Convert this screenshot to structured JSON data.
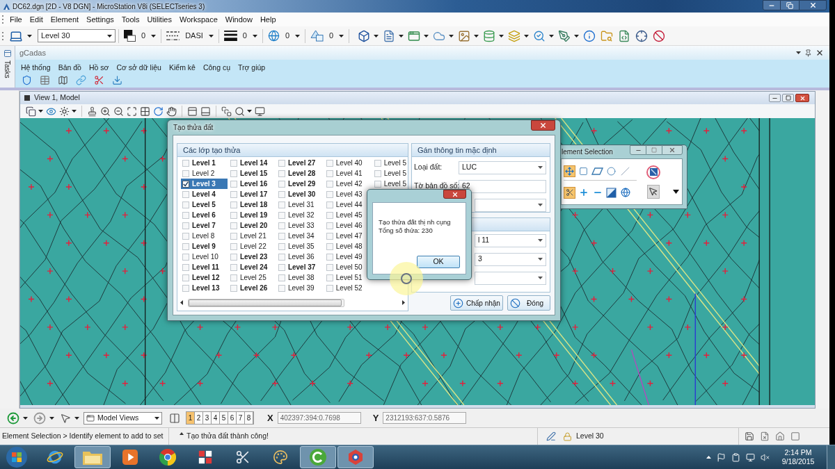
{
  "window": {
    "title": "DC62.dgn [2D - V8 DGN] - MicroStation V8i (SELECTseries 3)"
  },
  "menu": [
    "File",
    "Edit",
    "Element",
    "Settings",
    "Tools",
    "Utilities",
    "Workspace",
    "Window",
    "Help"
  ],
  "toolbar": {
    "level": "Level 30",
    "attributes": [
      {
        "kind": "color",
        "value": "0"
      },
      {
        "kind": "style",
        "value": "DASI"
      },
      {
        "kind": "weight",
        "value": "0"
      },
      {
        "kind": "globe",
        "value": "0"
      },
      {
        "kind": "shapes",
        "value": "0"
      }
    ]
  },
  "tasks_strip": {
    "label": "Tasks"
  },
  "gcadas": {
    "title": "gCadas",
    "menu": [
      "Hệ thống",
      "Bản đồ",
      "Hồ sơ",
      "Cơ sở dữ liệu",
      "Kiểm kê",
      "Công cụ",
      "Trợ giúp"
    ]
  },
  "view": {
    "title": "View 1, Model"
  },
  "dialog": {
    "title": "Tạo thửa đất",
    "levels": {
      "title": "Các lớp tạo thửa",
      "columns": [
        [
          {
            "label": "Level 1",
            "used": true,
            "checked": false,
            "selected": false
          },
          {
            "label": "Level 2",
            "used": false,
            "checked": false,
            "selected": false
          },
          {
            "label": "Level 3",
            "used": true,
            "checked": true,
            "selected": true
          },
          {
            "label": "Level 4",
            "used": true,
            "checked": false,
            "selected": false
          },
          {
            "label": "Level 5",
            "used": true,
            "checked": false,
            "selected": false
          },
          {
            "label": "Level 6",
            "used": true,
            "checked": false,
            "selected": false
          },
          {
            "label": "Level 7",
            "used": true,
            "checked": false,
            "selected": false
          },
          {
            "label": "Level 8",
            "used": false,
            "checked": false,
            "selected": false
          },
          {
            "label": "Level 9",
            "used": true,
            "checked": false,
            "selected": false
          },
          {
            "label": "Level 10",
            "used": false,
            "checked": false,
            "selected": false
          },
          {
            "label": "Level 11",
            "used": true,
            "checked": false,
            "selected": false
          },
          {
            "label": "Level 12",
            "used": true,
            "checked": false,
            "selected": false
          },
          {
            "label": "Level 13",
            "used": true,
            "checked": false,
            "selected": false
          }
        ],
        [
          {
            "label": "Level 14",
            "used": true,
            "checked": false,
            "selected": false
          },
          {
            "label": "Level 15",
            "used": true,
            "checked": false,
            "selected": false
          },
          {
            "label": "Level 16",
            "used": true,
            "checked": false,
            "selected": false
          },
          {
            "label": "Level 17",
            "used": true,
            "checked": false,
            "selected": false
          },
          {
            "label": "Level 18",
            "used": true,
            "checked": false,
            "selected": false
          },
          {
            "label": "Level 19",
            "used": true,
            "checked": false,
            "selected": false
          },
          {
            "label": "Level 20",
            "used": true,
            "checked": false,
            "selected": false
          },
          {
            "label": "Level 21",
            "used": false,
            "checked": false,
            "selected": false
          },
          {
            "label": "Level 22",
            "used": false,
            "checked": false,
            "selected": false
          },
          {
            "label": "Level 23",
            "used": true,
            "checked": false,
            "selected": false
          },
          {
            "label": "Level 24",
            "used": true,
            "checked": false,
            "selected": false
          },
          {
            "label": "Level 25",
            "used": false,
            "checked": false,
            "selected": false
          },
          {
            "label": "Level 26",
            "used": true,
            "checked": false,
            "selected": false
          }
        ],
        [
          {
            "label": "Level 27",
            "used": true,
            "checked": false,
            "selected": false
          },
          {
            "label": "Level 28",
            "used": true,
            "checked": false,
            "selected": false
          },
          {
            "label": "Level 29",
            "used": true,
            "checked": false,
            "selected": false
          },
          {
            "label": "Level 30",
            "used": true,
            "checked": false,
            "selected": false
          },
          {
            "label": "Level 31",
            "used": false,
            "checked": false,
            "selected": false
          },
          {
            "label": "Level 32",
            "used": false,
            "checked": false,
            "selected": false
          },
          {
            "label": "Level 33",
            "used": false,
            "checked": false,
            "selected": false
          },
          {
            "label": "Level 34",
            "used": false,
            "checked": false,
            "selected": false
          },
          {
            "label": "Level 35",
            "used": false,
            "checked": false,
            "selected": false
          },
          {
            "label": "Level 36",
            "used": false,
            "checked": false,
            "selected": false
          },
          {
            "label": "Level 37",
            "used": true,
            "checked": false,
            "selected": false
          },
          {
            "label": "Level 38",
            "used": false,
            "checked": false,
            "selected": false
          },
          {
            "label": "Level 39",
            "used": false,
            "checked": false,
            "selected": false
          }
        ],
        [
          {
            "label": "Level 40",
            "used": false,
            "checked": false,
            "selected": false
          },
          {
            "label": "Level 41",
            "used": false,
            "checked": false,
            "selected": false
          },
          {
            "label": "Level 42",
            "used": false,
            "checked": false,
            "selected": false
          },
          {
            "label": "Level 43",
            "used": false,
            "checked": false,
            "selected": false
          },
          {
            "label": "Level 44",
            "used": false,
            "checked": false,
            "selected": false
          },
          {
            "label": "Level 45",
            "used": false,
            "checked": false,
            "selected": false
          },
          {
            "label": "Level 46",
            "used": false,
            "checked": false,
            "selected": false
          },
          {
            "label": "Level 47",
            "used": false,
            "checked": false,
            "selected": false
          },
          {
            "label": "Level 48",
            "used": false,
            "checked": false,
            "selected": false
          },
          {
            "label": "Level 49",
            "used": false,
            "checked": false,
            "selected": false
          },
          {
            "label": "Level 50",
            "used": false,
            "checked": false,
            "selected": false
          },
          {
            "label": "Level 51",
            "used": false,
            "checked": false,
            "selected": false
          },
          {
            "label": "Level 52",
            "used": false,
            "checked": false,
            "selected": false
          }
        ],
        [
          {
            "label": "Level 5",
            "used": false,
            "checked": false,
            "selected": false
          },
          {
            "label": "Level 5",
            "used": false,
            "checked": false,
            "selected": false
          },
          {
            "label": "Level 5",
            "used": false,
            "checked": false,
            "selected": false
          }
        ]
      ]
    },
    "defaults": {
      "title": "Gán thông tin mặc định",
      "fields": [
        {
          "kind": "dropdown",
          "label": "Loại đất:",
          "value": "LUC"
        },
        {
          "kind": "text",
          "label": "Tờ bản đồ số:",
          "value": "62"
        },
        {
          "kind": "dropdown"
        }
      ]
    },
    "options": {
      "fields": [
        {
          "kind": "dropdown",
          "value": "l 11"
        },
        {
          "kind": "dropdown",
          "value": "3"
        },
        {
          "kind": "dropdown"
        }
      ]
    },
    "buttons": [
      {
        "kind": "accept",
        "label": "Chấp nhận"
      },
      {
        "kind": "close",
        "label": "Đóng"
      }
    ]
  },
  "message_box": {
    "lines": [
      "Tạo thửa đất thị nh cụng",
      "Tổng số thửa: 230"
    ],
    "button": "OK"
  },
  "element_selection": {
    "title": "lement Selection"
  },
  "bottom_toolbar": {
    "view_group": "Model Views",
    "views": [
      {
        "label": "1",
        "selected": true
      },
      {
        "label": "2",
        "selected": false
      },
      {
        "label": "3",
        "selected": false
      },
      {
        "label": "4",
        "selected": false
      },
      {
        "label": "5",
        "selected": false
      },
      {
        "label": "6",
        "selected": false
      },
      {
        "label": "7",
        "selected": false
      },
      {
        "label": "8",
        "selected": false
      }
    ],
    "x": {
      "label": "X",
      "value": "402397:394:0.7698"
    },
    "y": {
      "label": "Y",
      "value": "2312193:637:0.5876"
    }
  },
  "status_bar": {
    "prompt": "Element Selection > Identify element to add to set",
    "message": "Tạo thửa đất thành công!",
    "level": "Level 30"
  },
  "taskbar": {
    "apps": [
      {
        "kind": "ie",
        "active": false
      },
      {
        "kind": "folder",
        "active": true
      },
      {
        "kind": "media",
        "active": false
      },
      {
        "kind": "chrome",
        "active": false
      },
      {
        "kind": "grid",
        "active": false
      },
      {
        "kind": "tool",
        "active": false
      },
      {
        "kind": "paint",
        "active": false
      },
      {
        "kind": "cadas",
        "active": true
      },
      {
        "kind": "ring",
        "active": true
      }
    ],
    "time": "2:14 PM",
    "date": "9/18/2015"
  }
}
